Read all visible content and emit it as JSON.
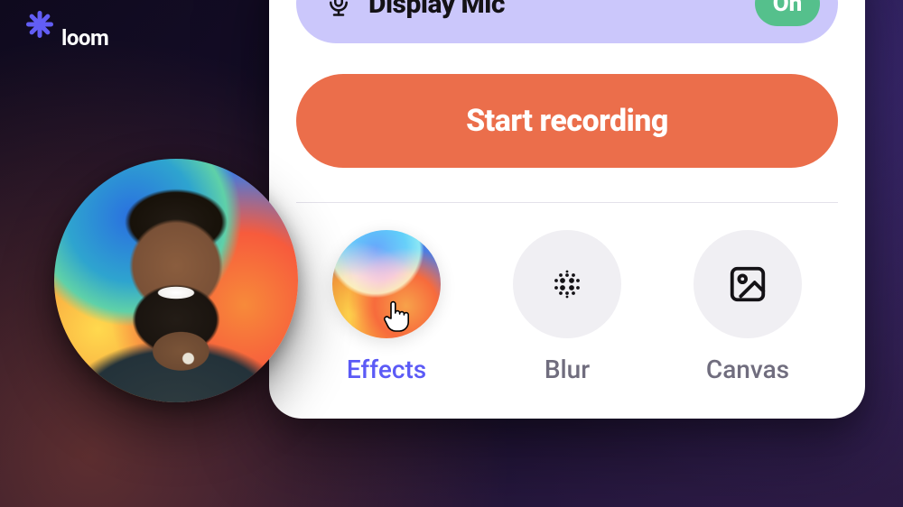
{
  "brand": {
    "name": "loom"
  },
  "mic": {
    "label": "Display Mic",
    "toggle": "On",
    "icon_name": "mic-icon"
  },
  "record_button": {
    "label": "Start recording"
  },
  "tools": {
    "effects": {
      "label": "Effects",
      "icon_name": "effects-icon",
      "active": true
    },
    "blur": {
      "label": "Blur",
      "icon_name": "blur-dots-icon"
    },
    "canvas": {
      "label": "Canvas",
      "icon_name": "image-icon"
    }
  },
  "camera_bubble": {
    "description": "camera preview with colorful background"
  },
  "colors": {
    "accent_purple": "#625DF5",
    "record_orange": "#EB6E4B",
    "mic_lavender": "#CBC7FB",
    "toggle_green": "#55C08C"
  }
}
